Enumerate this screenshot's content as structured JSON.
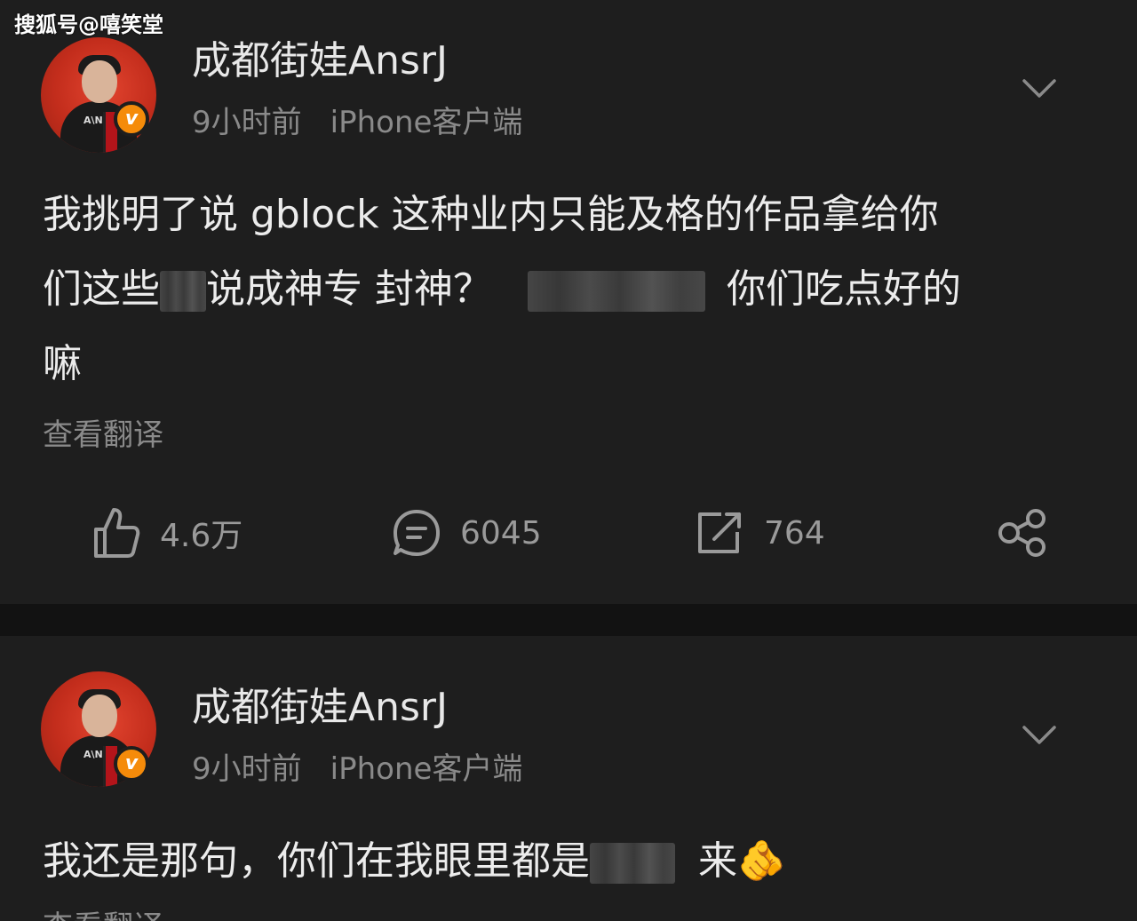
{
  "watermark": "搜狐号@嘻笑堂",
  "posts": [
    {
      "author": "成都街娃AnsrJ",
      "time": "9小时前",
      "source": "iPhone客户端",
      "avatar_letters": "A\\N",
      "verified_mark": "v",
      "content": {
        "line1": "我挑明了说 gblock 这种业内只能及格的作品拿给你",
        "line2a": "们这些",
        "line2b": "说成神专 封神？",
        "line2c": "你们吃点好的",
        "line3": "嘛"
      },
      "translate_label": "查看翻译",
      "actions": {
        "like": "4.6万",
        "comment": "6045",
        "repost": "764"
      }
    },
    {
      "author": "成都街娃AnsrJ",
      "time": "9小时前",
      "source": "iPhone客户端",
      "avatar_letters": "A\\N",
      "verified_mark": "v",
      "content": {
        "line1a": "我还是那句，你们在我眼里都是",
        "line1b": "来",
        "emoji": "🫵"
      },
      "translate_label": "查看翻译"
    }
  ],
  "colors": {
    "background": "#1e1e1e",
    "separator": "#121212",
    "verified_badge": "#f58b0a",
    "secondary_text": "#8a8a8a"
  },
  "icons": [
    "like-icon",
    "comment-icon",
    "repost-icon",
    "share-icon",
    "chevron-down-icon",
    "verified-icon"
  ]
}
